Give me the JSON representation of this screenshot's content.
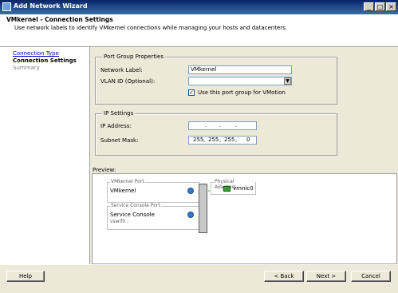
{
  "window": {
    "title": "Add Network Wizard"
  },
  "header": {
    "title": "VMkernel - Connection Settings",
    "subtitle": "Use network labels to identify VMkernel connections while managing your hosts and datacenters."
  },
  "nav": {
    "items": [
      {
        "label": "Connection Type",
        "state": "link"
      },
      {
        "label": "Connection Settings",
        "state": "current"
      },
      {
        "label": "Summary",
        "state": "disabled"
      }
    ]
  },
  "port_group": {
    "group_title": "Port Group Properties",
    "network_label_label": "Network Label:",
    "network_label_value": "VMkernel",
    "vlan_label": "VLAN ID (Optional):",
    "vlan_value": "",
    "vmotion_label": "Use this port group for VMotion",
    "vmotion_checked": true
  },
  "ip_settings": {
    "group_title": "IP Settings",
    "ip_label": "IP Address:",
    "ip_octets": [
      "",
      "",
      "",
      ""
    ],
    "mask_label": "Subnet Mask:",
    "mask_octets": [
      "255",
      "255",
      "255",
      "0"
    ]
  },
  "preview": {
    "label": "Preview:",
    "vmkernel_port_tag": "VMkernel Port",
    "vmkernel_port_name": "VMkernel",
    "console_port_tag": "Service Console Port",
    "console_port_name": "Service Console",
    "console_port_sub": "vswif0 :",
    "adapters_tag": "Physical Adapters",
    "adapter_name": "vmnic0"
  },
  "buttons": {
    "help": "Help",
    "back": "< Back",
    "next": "Next >",
    "cancel": "Cancel"
  },
  "titlebar_buttons": {
    "minimize": "_",
    "maximize": "□",
    "close": "×"
  },
  "icons": [
    "network-icon",
    "nic-icon",
    "dropdown-arrow-icon",
    "checkmark-icon",
    "window-icon"
  ],
  "colors": {
    "title_bar": "#0a246a",
    "link": "#0000c0",
    "nic": "#3a9a3a",
    "network": "#3a78c0"
  }
}
